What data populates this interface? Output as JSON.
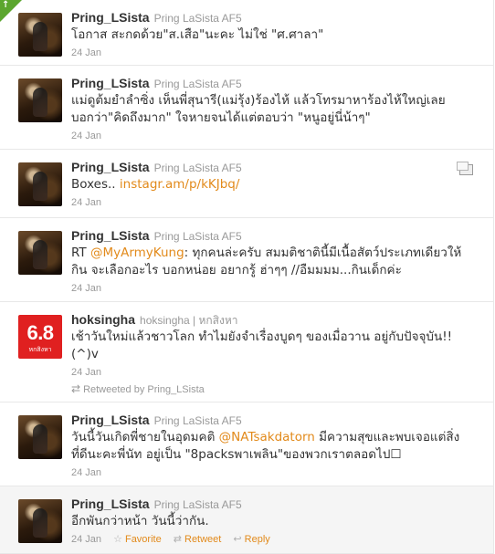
{
  "tweets": [
    {
      "username": "Pring_LSista",
      "fullname": "Pring LaSista AF5",
      "text": "โอกาส สะกดด้วย\"ส.เสือ\"นะคะ ไม่ใช่ \"ศ.ศาลา\"",
      "time": "24 Jan"
    },
    {
      "username": "Pring_LSista",
      "fullname": "Pring LaSista AF5",
      "text_line1": "แม่ดูต้มยำลำซิ่ง เห็นพี่สุนารี(แม่รุ้ง)ร้องไห้ แล้วโทรมาหาร้องไห้ใหญ่เลย",
      "text_line2": "บอกว่า\"คิดถึงมาก\" ใจหายจนได้แต่ตอบว่า \"หนูอยู่นี่น้าๆ\"",
      "time": "24 Jan"
    },
    {
      "username": "Pring_LSista",
      "fullname": "Pring LaSista AF5",
      "text": "Boxes..",
      "link": "instagr.am/p/kKJbq/",
      "time": "24 Jan",
      "media_icon": "photo-media-icon"
    },
    {
      "username": "Pring_LSista",
      "fullname": "Pring LaSista AF5",
      "prefix": "RT",
      "mention": "@MyArmyKung",
      "text_line1_rest": ": ทุกคนล่ะครับ สมมติชาตินี้มีเนื้อสัตว์ประเภทเดียวให้",
      "text_line2": "กิน จะเลือกอะไร บอกหน่อย อยากรู้ ฮ่าๆๆ //อืมมมม...กินเด็กค่ะ",
      "time": "24 Jan"
    },
    {
      "username": "hoksingha",
      "fullname": "hoksingha | หกสิงหา",
      "avatar_number": "6.8",
      "avatar_label": "หกสิงหา",
      "text_line1": "เช้าวันใหม่แล้วชาวโลก ทำไมยังจำเรื่องบูดๆ ของเมื่อวาน อยู่กับปัจจุบัน!!",
      "text_line2": "(^)v",
      "time": "24 Jan",
      "retweeted_by": "Retweeted by Pring_LSista"
    },
    {
      "username": "Pring_LSista",
      "fullname": "Pring LaSista AF5",
      "text_line1_pre": "วันนี้วันเกิดพี่ชายในอุดมคติ",
      "mention": "@NATsakdatorn",
      "text_line1_post": "มีความสุขและพบเจอแต่สิ่ง",
      "text_line2": "ที่ดีนะคะพี่นัท อยู่เป็น \"8packsพาเพลิน\"ของพวกเราตลอดไป☐",
      "time": "24 Jan"
    },
    {
      "username": "Pring_LSista",
      "fullname": "Pring LaSista AF5",
      "text": "อีกพันกว่าหน้า วันนี้ว่ากัน.",
      "time": "24 Jan",
      "actions": {
        "favorite": "Favorite",
        "retweet": "Retweet",
        "reply": "Reply"
      }
    }
  ],
  "colors": {
    "link": "#e28a1b",
    "meta": "#999999",
    "highlight_bg": "#f5f5f5",
    "corner_badge": "#5ba62e",
    "brand_avatar": "#e02020"
  }
}
